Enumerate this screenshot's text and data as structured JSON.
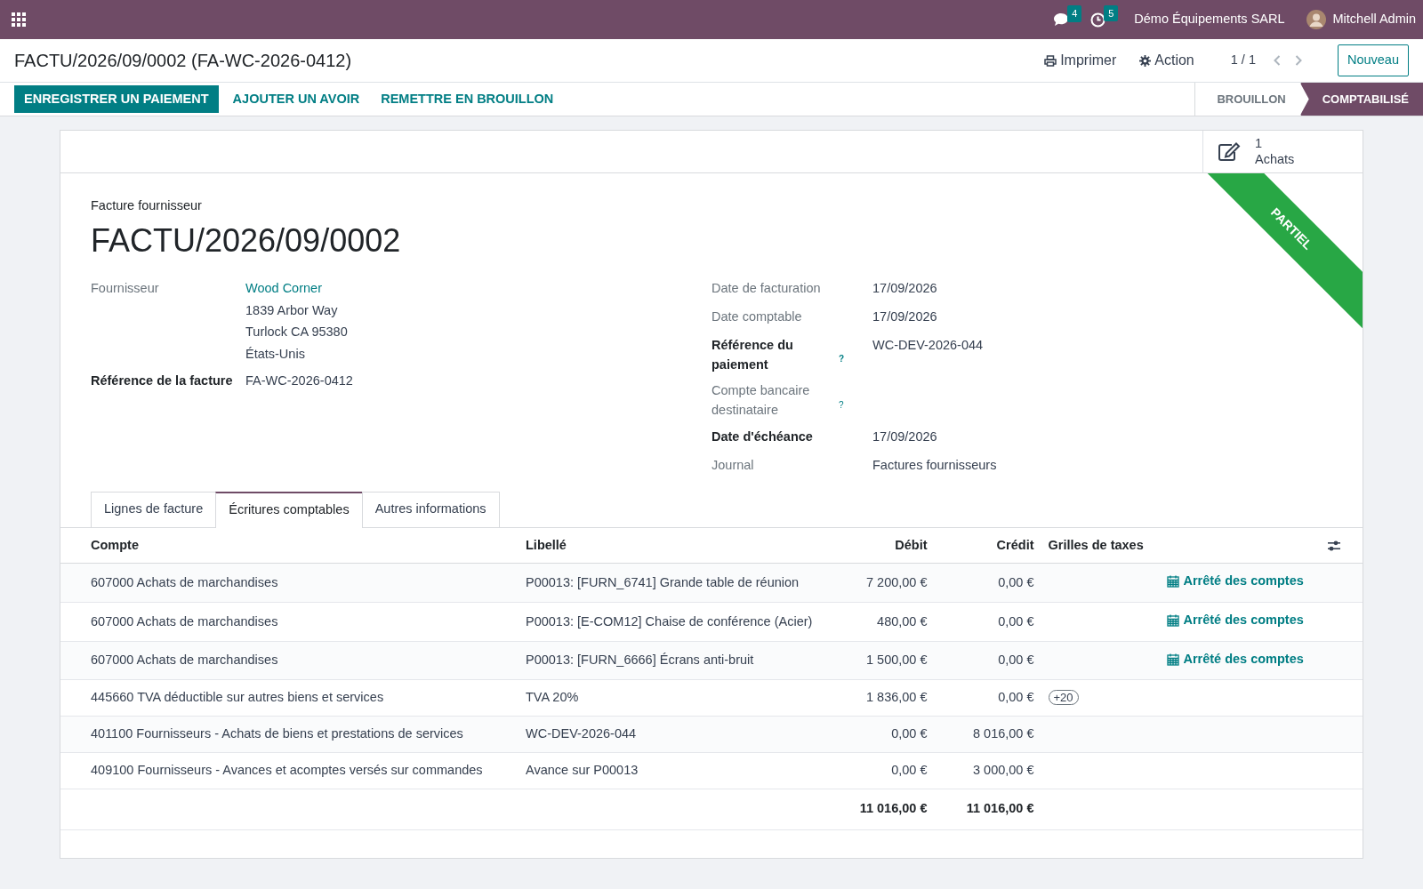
{
  "top_bar": {
    "messages_count": "4",
    "activities_count": "5",
    "company": "Démo Équipements SARL",
    "user": "Mitchell Admin"
  },
  "breadcrumb": "FACTU/2026/09/0002 (FA-WC-2026-0412)",
  "control_panel": {
    "print": "Imprimer",
    "action": "Action",
    "pager": "1 / 1",
    "new_button": "Nouveau"
  },
  "action_buttons": [
    {
      "label": "ENREGISTRER UN PAIEMENT",
      "primary": true
    },
    {
      "label": "AJOUTER UN AVOIR",
      "primary": false
    },
    {
      "label": "REMETTRE EN BROUILLON",
      "primary": false
    }
  ],
  "status_steps": [
    {
      "label": "BROUILLON",
      "selected": false
    },
    {
      "label": "COMPTABILISÉ",
      "selected": true
    }
  ],
  "smart_button": {
    "count": "1",
    "label": "Achats"
  },
  "ribbon": "PARTIEL",
  "document_type": "Facture fournisseur",
  "document_name": "FACTU/2026/09/0002",
  "left_fields": [
    {
      "label": "Fournisseur",
      "bold": false,
      "value_link": "Wood Corner",
      "address": [
        "1839 Arbor Way",
        "Turlock CA 95380",
        "États-Unis"
      ]
    },
    {
      "label": "Référence de la facture",
      "bold": true,
      "value": "FA-WC-2026-0412"
    }
  ],
  "right_fields": [
    {
      "label": "Date de facturation",
      "bold": false,
      "help": false,
      "value": "17/09/2026"
    },
    {
      "label": "Date comptable",
      "bold": false,
      "help": false,
      "value": "17/09/2026"
    },
    {
      "label": "Référence du paiement",
      "bold": true,
      "help": true,
      "value": "WC-DEV-2026-044"
    },
    {
      "label": "Compte bancaire destinataire",
      "bold": false,
      "help": true
    },
    {
      "label": "Date d'échéance",
      "bold": true,
      "help": false,
      "value": "17/09/2026"
    },
    {
      "label": "Journal",
      "bold": false,
      "help": false,
      "value": "Factures fournisseurs"
    }
  ],
  "help_mark": "?",
  "tabs": [
    {
      "label": "Lignes de facture",
      "selected": false
    },
    {
      "label": "Écritures comptables",
      "selected": true
    },
    {
      "label": "Autres informations",
      "selected": false
    }
  ],
  "table": {
    "columns": [
      "Compte",
      "Libellé",
      "Débit",
      "Crédit",
      "Grilles de taxes"
    ],
    "rows": [
      {
        "account": "607000 Achats de marchandises",
        "label": "P00013: [FURN_6741] Grande table de réunion",
        "debit": "7 200,00 €",
        "credit": "0,00 €",
        "link": "Arrêté des comptes"
      },
      {
        "account": "607000 Achats de marchandises",
        "label": "P00013: [E-COM12] Chaise de conférence (Acier)",
        "debit": "480,00 €",
        "credit": "0,00 €",
        "link": "Arrêté des comptes"
      },
      {
        "account": "607000 Achats de marchandises",
        "label": "P00013: [FURN_6666] Écrans anti-bruit",
        "debit": "1 500,00 €",
        "credit": "0,00 €",
        "link": "Arrêté des comptes"
      },
      {
        "account": "445660 TVA déductible sur autres biens et services",
        "label": "TVA 20%",
        "debit": "1 836,00 €",
        "credit": "0,00 €",
        "tags": [
          "+20"
        ]
      },
      {
        "account": "401100 Fournisseurs - Achats de biens et prestations de services",
        "label": "WC-DEV-2026-044",
        "debit": "0,00 €",
        "credit": "8 016,00 €"
      },
      {
        "account": "409100 Fournisseurs - Avances et acomptes versés sur commandes",
        "label": "Avance sur P00013",
        "debit": "0,00 €",
        "credit": "3 000,00 €"
      }
    ],
    "total_debit": "11 016,00 €",
    "total_credit": "11 016,00 €"
  }
}
